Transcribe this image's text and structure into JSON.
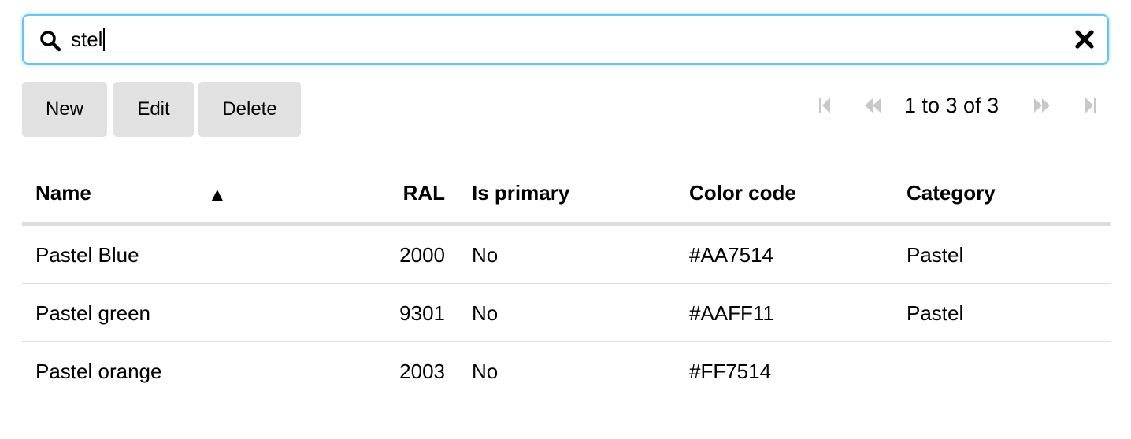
{
  "search": {
    "value": "stel",
    "search_icon": "search-icon",
    "clear_icon": "close-icon"
  },
  "toolbar": {
    "new_label": "New",
    "edit_label": "Edit",
    "delete_label": "Delete"
  },
  "pager": {
    "text": "1 to 3 of 3",
    "icons": [
      "first-page-icon",
      "previous-page-icon",
      "next-page-icon",
      "last-page-icon"
    ]
  },
  "table": {
    "columns": [
      "Name",
      "RAL",
      "Is primary",
      "Color code",
      "Category"
    ],
    "sort_indicator": "▲",
    "rows": [
      {
        "name": "Pastel Blue",
        "ral": "2000",
        "is_primary": "No",
        "color_code": "#AA7514",
        "category": "Pastel"
      },
      {
        "name": "Pastel green",
        "ral": "9301",
        "is_primary": "No",
        "color_code": "#AAFF11",
        "category": "Pastel"
      },
      {
        "name": "Pastel orange",
        "ral": "2003",
        "is_primary": "No",
        "color_code": "#FF7514",
        "category": ""
      }
    ]
  },
  "colors": {
    "focus_border": "#6cc4ec",
    "button_bg": "#e1e1e1",
    "pager_disabled": "#c8c8c8",
    "rule": "#dddddd"
  }
}
